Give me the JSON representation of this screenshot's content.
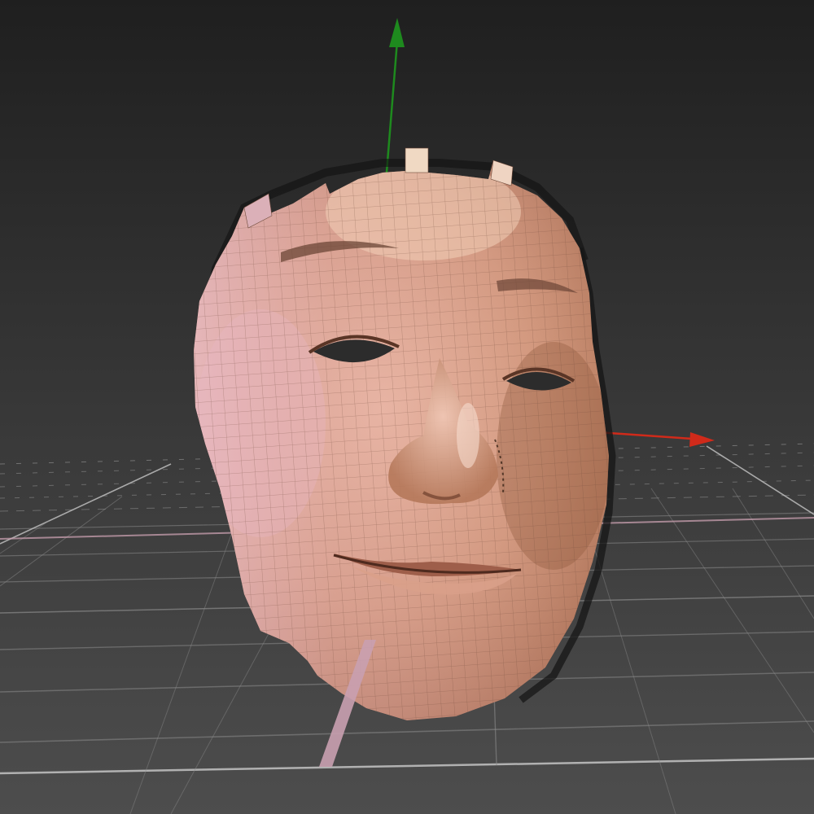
{
  "viewport": {
    "kind": "3d-viewport",
    "background_top": "#1f1f1f",
    "background_bottom": "#4a4a4a",
    "grid_color": "#8a8a8a",
    "ground_axis_color": "#c9a0b0"
  },
  "gizmo": {
    "y_axis_color": "#1e8a1e",
    "x_axis_color": "#d02a1a",
    "z_axis_color": "#c9a0b0"
  },
  "model": {
    "object": "face-scan-mesh",
    "skin_color": "#c98f6e",
    "wireframe_color": "#6e4a3a"
  }
}
